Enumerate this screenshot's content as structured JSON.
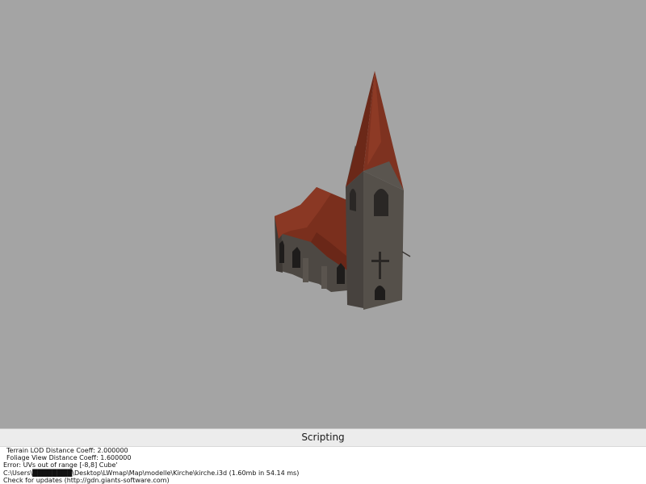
{
  "viewport": {
    "background": "#a4a4a4",
    "model": "church-model"
  },
  "panel": {
    "title": "Scripting"
  },
  "console": {
    "lines": [
      "Terrain LOD Distance Coeff: 2.000000",
      "Foliage View Distance Coeff: 1.600000",
      "Error: UVs out of range [-8,8] Cube'",
      "C:\\Users\\████████\\Desktop\\LWmap\\Map\\modelle\\Kirche\\kirche.i3d (1.60mb in 54.14 ms)",
      "Check for updates (http://gdn.giants-software.com)"
    ]
  },
  "colors": {
    "roof": "#7a2f1d",
    "wall": "#4a4541",
    "panel_bg": "#ececec",
    "console_bg": "#ffffff"
  }
}
